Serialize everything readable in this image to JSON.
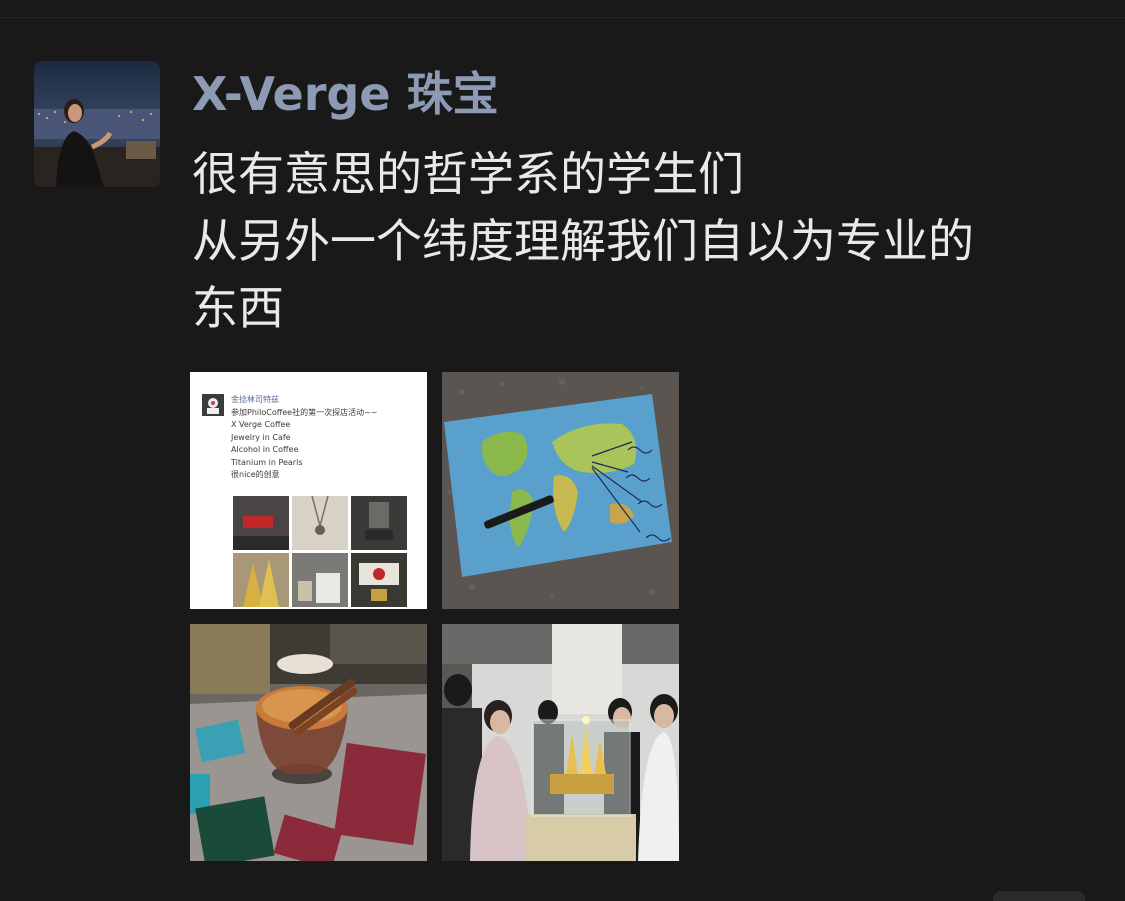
{
  "post": {
    "author": "X-Verge 珠宝",
    "text_lines": [
      "很有意思的哲学系的学生们",
      "从另外一个纬度理解我们自以为专业的",
      "东西"
    ]
  },
  "photos": {
    "repost_card": {
      "name": "金捻林司特兹",
      "lines": [
        "参加PhiloCoffee社的第一次探店活动~~",
        "X Verge Coffee",
        "Jewelry in Cafe",
        "Alcohol in Coffee",
        "Titanium in Pearls",
        "很nice的创意"
      ]
    }
  },
  "colors": {
    "background": "#191919",
    "author": "#8c9ab4",
    "text": "#e9e9e9"
  }
}
